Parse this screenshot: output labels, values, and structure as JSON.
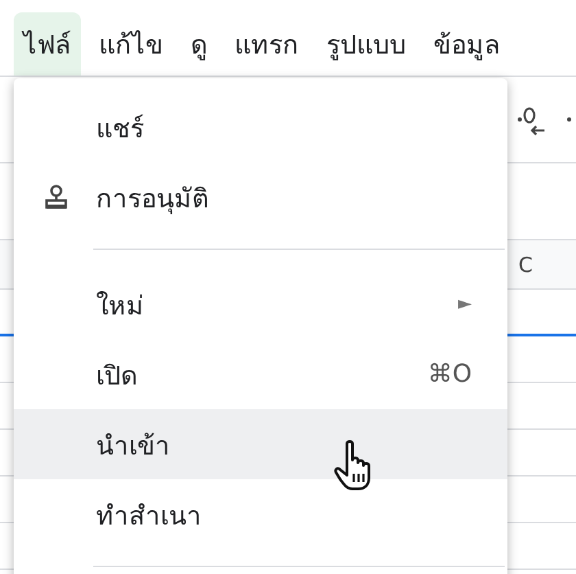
{
  "menubar": [
    {
      "label": "ไฟล์",
      "selected": true
    },
    {
      "label": "แก้ไข",
      "selected": false
    },
    {
      "label": "ดู",
      "selected": false
    },
    {
      "label": "แทรก",
      "selected": false
    },
    {
      "label": "รูปแบบ",
      "selected": false
    },
    {
      "label": "ข้อมูล",
      "selected": false
    }
  ],
  "sheet": {
    "column_header": "C"
  },
  "file_menu": {
    "items": [
      {
        "kind": "plain",
        "label": "แชร์",
        "highlighted": false
      },
      {
        "kind": "stamp",
        "label": "การอนุมัติ",
        "highlighted": false
      },
      {
        "kind": "divider"
      },
      {
        "kind": "submenu",
        "label": "ใหม่",
        "arrow": "►",
        "highlighted": false
      },
      {
        "kind": "shortcut",
        "label": "เปิด",
        "shortcut": "⌘O",
        "highlighted": false
      },
      {
        "kind": "plain",
        "label": "นำเข้า",
        "highlighted": true
      },
      {
        "kind": "plain",
        "label": "ทำสำเนา",
        "highlighted": false
      },
      {
        "kind": "divider"
      }
    ]
  }
}
